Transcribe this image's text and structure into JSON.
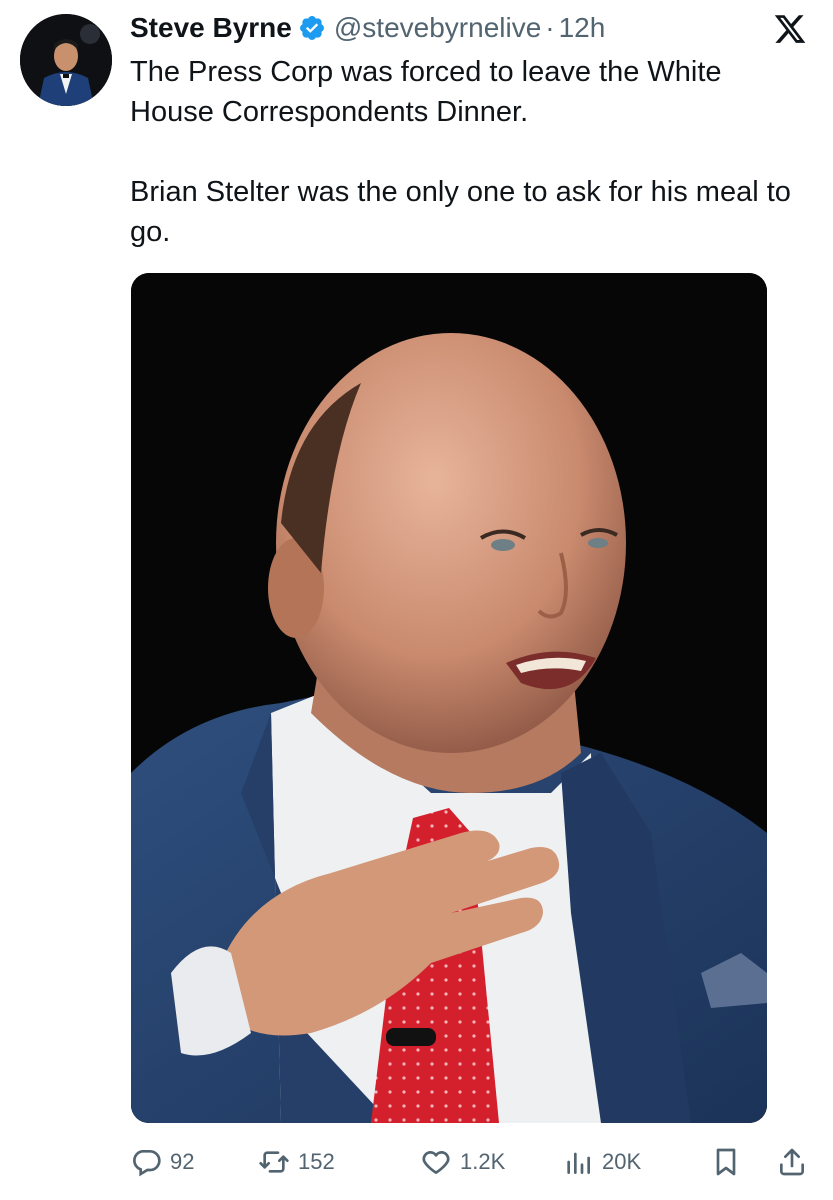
{
  "author": {
    "name": "Steve Byrne",
    "handle": "@stevebyrnelive",
    "separator": "·",
    "time": "12h",
    "verified": true
  },
  "platform_icon": "x-logo-icon",
  "tweet": {
    "paragraphs": [
      "The Press Corp was forced to leave the White House Correspondents Dinner.",
      "Brian Stelter was the only one to ask for his meal to go."
    ]
  },
  "media": {
    "description_icon": "photo-man-in-blue-suit-red-tie"
  },
  "actions": {
    "replies": "92",
    "reposts": "152",
    "likes": "1.2K",
    "views": "20K"
  },
  "colors": {
    "text": "#0f1419",
    "secondary": "#536471",
    "verified": "#1d9bf0",
    "background": "#ffffff"
  }
}
